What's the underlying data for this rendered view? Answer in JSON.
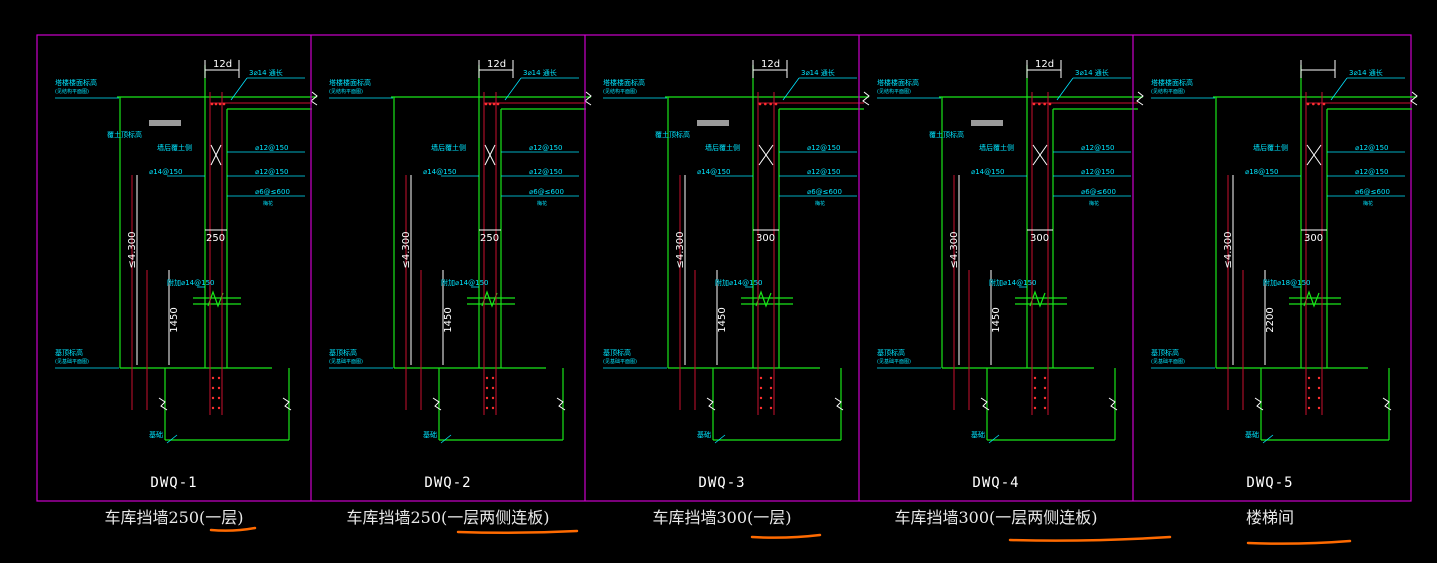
{
  "colors": {
    "background": "#000000",
    "frame": "#cc00cc",
    "wall_lines": "#19e619",
    "rebar": "#c8102e",
    "annotation": "#00e5ff",
    "dimension": "#ffffff",
    "underline": "#ff6a00"
  },
  "panels": [
    {
      "drawing_label": "DWQ-1",
      "section_title": "车库挡墙250(一层)",
      "texts": {
        "top_level": "塔楼楼面标高",
        "top_level_sub": "(见结构平面图)",
        "top_rebar": "3⌀14 通长",
        "lap": "12d",
        "fill_level": "覆土顶标高",
        "soil_side": "墙后覆土侧",
        "bar_a": "⌀12@150",
        "bar_b": "⌀14@150",
        "bar_c": "⌀12@150",
        "tie": "⌀6@≤600",
        "tie_sub": "梅花",
        "height": "≤4.300",
        "thickness": "250",
        "vert_bar": "附加⌀14@150",
        "lower_height": "1450",
        "base_level": "基顶标高",
        "base_level_sub": "(见基础平面图)",
        "foundation": "基础"
      }
    },
    {
      "drawing_label": "DWQ-2",
      "section_title": "车库挡墙250(一层两侧连板)",
      "texts": {
        "top_level": "塔楼楼面标高",
        "top_level_sub": "(见结构平面图)",
        "top_rebar": "3⌀14 通长",
        "lap": "12d",
        "fill_level": "",
        "soil_side": "墙后覆土侧",
        "bar_a": "⌀12@150",
        "bar_b": "⌀14@150",
        "bar_c": "⌀12@150",
        "tie": "⌀6@≤600",
        "tie_sub": "梅花",
        "height": "≤4.300",
        "thickness": "250",
        "vert_bar": "附加⌀14@150",
        "lower_height": "1450",
        "base_level": "基顶标高",
        "base_level_sub": "(见基础平面图)",
        "foundation": "基础"
      }
    },
    {
      "drawing_label": "DWQ-3",
      "section_title": "车库挡墙300(一层)",
      "texts": {
        "top_level": "塔楼楼面标高",
        "top_level_sub": "(见结构平面图)",
        "top_rebar": "3⌀14 通长",
        "lap": "12d",
        "fill_level": "覆土顶标高",
        "soil_side": "墙后覆土侧",
        "bar_a": "⌀12@150",
        "bar_b": "⌀14@150",
        "bar_c": "⌀12@150",
        "tie": "⌀6@≤600",
        "tie_sub": "梅花",
        "height": "≤4.300",
        "thickness": "300",
        "vert_bar": "附加⌀14@150",
        "lower_height": "1450",
        "base_level": "基顶标高",
        "base_level_sub": "(见基础平面图)",
        "foundation": "基础"
      }
    },
    {
      "drawing_label": "DWQ-4",
      "section_title": "车库挡墙300(一层两侧连板)",
      "texts": {
        "top_level": "塔楼楼面标高",
        "top_level_sub": "(见结构平面图)",
        "top_rebar": "3⌀14 通长",
        "lap": "12d",
        "fill_level": "覆土顶标高",
        "soil_side": "墙后覆土侧",
        "bar_a": "⌀12@150",
        "bar_b": "⌀14@150",
        "bar_c": "⌀12@150",
        "tie": "⌀6@≤600",
        "tie_sub": "梅花",
        "height": "≤4.300",
        "thickness": "300",
        "vert_bar": "附加⌀14@150",
        "lower_height": "1450",
        "base_level": "基顶标高",
        "base_level_sub": "(见基础平面图)",
        "foundation": "基础"
      }
    },
    {
      "drawing_label": "DWQ-5",
      "section_title": "楼梯间",
      "texts": {
        "top_level": "塔楼楼面标高",
        "top_level_sub": "(见结构平面图)",
        "top_rebar": "3⌀14 通长",
        "lap": "",
        "fill_level": "",
        "soil_side": "墙后覆土侧",
        "bar_a": "⌀12@150",
        "bar_b": "⌀18@150",
        "bar_c": "⌀12@150",
        "tie": "⌀6@≤600",
        "tie_sub": "梅花",
        "height": "≤4.300",
        "thickness": "300",
        "vert_bar": "附加⌀18@150",
        "lower_height": "2200",
        "base_level": "基顶标高",
        "base_level_sub": "(见基础平面图)",
        "foundation": "基础"
      }
    }
  ]
}
